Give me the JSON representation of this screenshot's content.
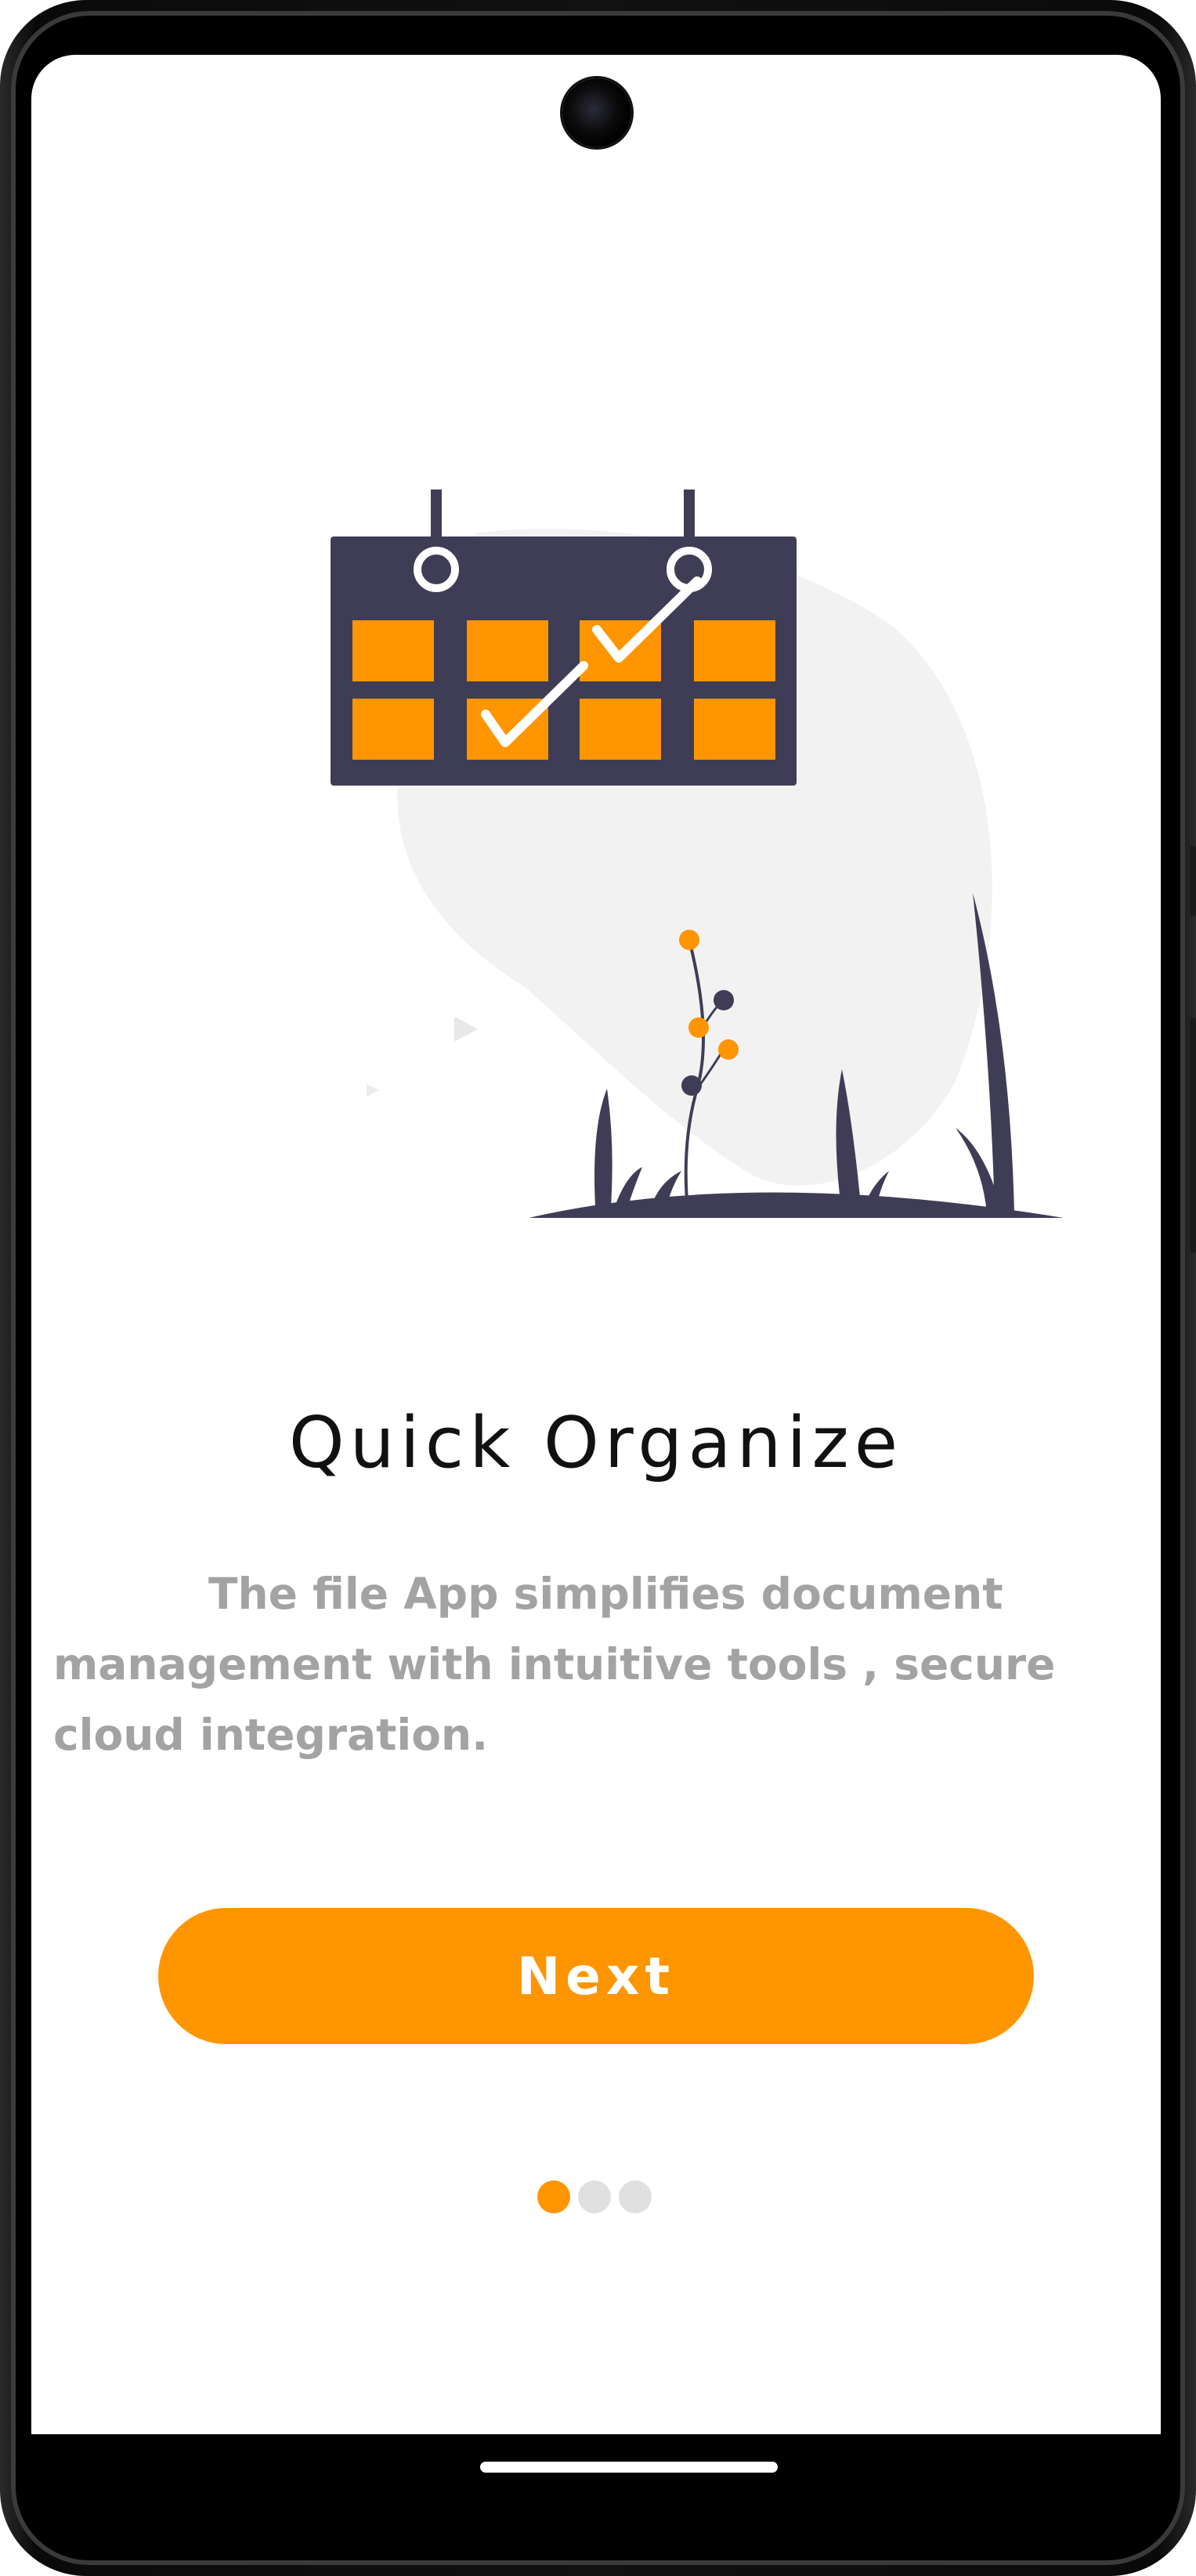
{
  "onboarding": {
    "title": "Quick Organize",
    "description": "The file App simplifies document management with intuitive tools , secure cloud integration.",
    "next_label": "Next",
    "page_indicator": {
      "total": 3,
      "current": 1
    }
  },
  "colors": {
    "accent": "#ff9500",
    "illustration_dark": "#3f3d56",
    "blob": "#f2f2f2",
    "text_muted": "#a3a3a3",
    "title": "#111111",
    "dot_inactive": "#e0e0e0"
  },
  "icons": {
    "illustration": "calendar-checklist-illustration",
    "camera": "front-camera-icon"
  }
}
